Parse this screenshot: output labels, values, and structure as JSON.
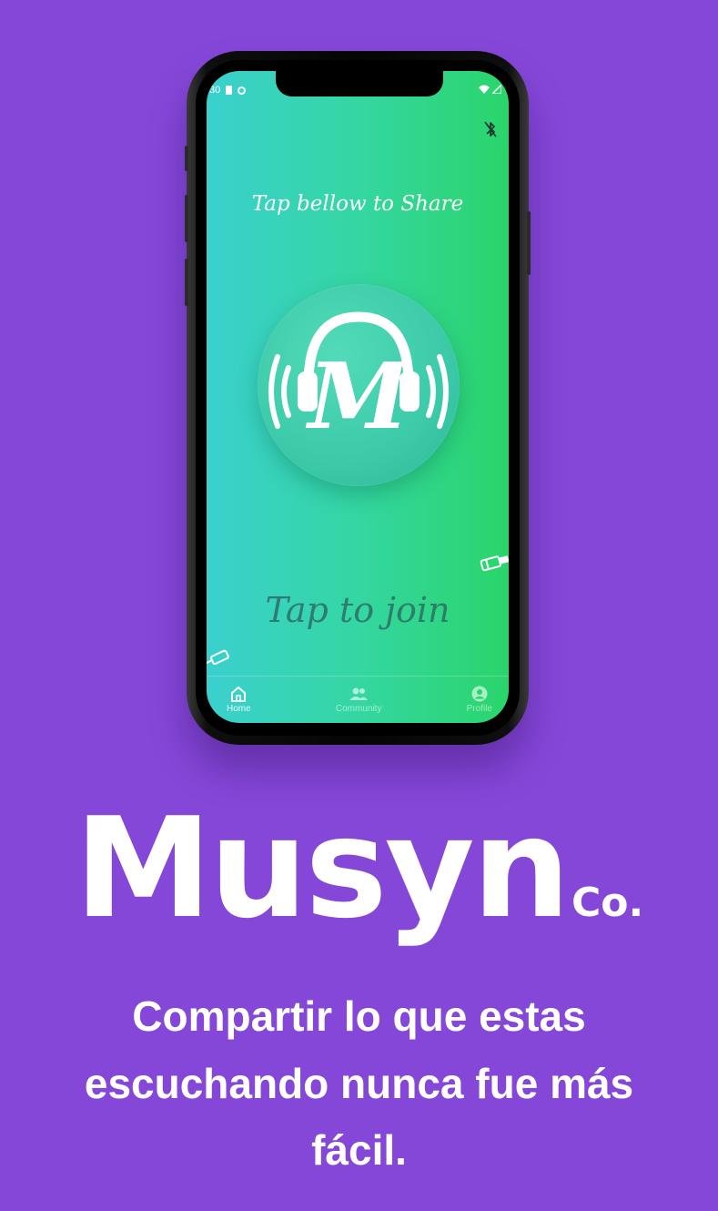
{
  "colors": {
    "background": "#8547d8",
    "screen_gradient_start": "#3ad0cf",
    "screen_gradient_end": "#2ad56a",
    "white": "#ffffff"
  },
  "phone": {
    "status_bar": {
      "time": "30",
      "icons_left": [
        "sd-card-icon",
        "circle-icon"
      ],
      "icons_right": [
        "wifi-icon",
        "signal-icon"
      ]
    },
    "bluetooth_icon": "bluetooth-off-icon",
    "share_prompt": "Tap bellow to Share",
    "logo_letter": "M",
    "join_prompt": "Tap to join",
    "nav": [
      {
        "label": "Home",
        "icon": "home-icon",
        "active": true
      },
      {
        "label": "Community",
        "icon": "people-icon",
        "active": false
      },
      {
        "label": "Profile",
        "icon": "account-icon",
        "active": false
      }
    ]
  },
  "brand": {
    "name": "Musyn",
    "suffix": "Co."
  },
  "tagline": "Compartir lo que estas escuchando nunca fue más fácil."
}
